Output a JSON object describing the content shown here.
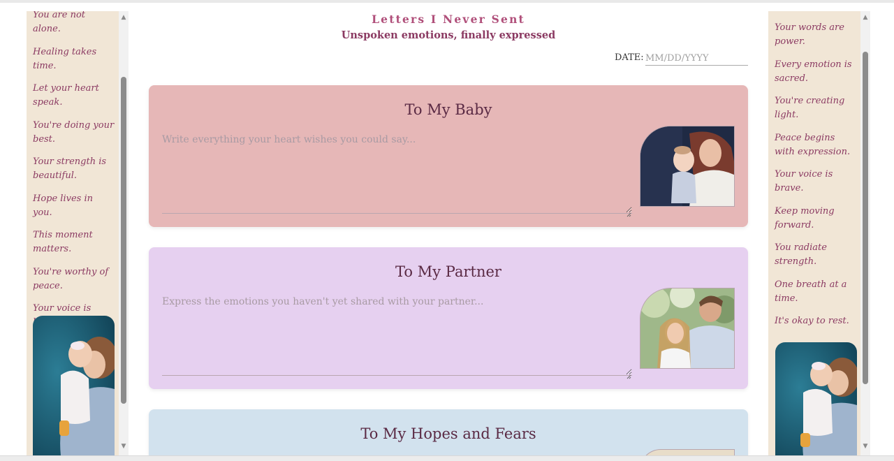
{
  "header": {
    "title": "Letters I Never Sent",
    "subtitle": "Unspoken emotions, finally expressed",
    "date_label": "DATE:",
    "date_placeholder": "MM/DD/YYYY"
  },
  "left_panel": {
    "quotes": [
      "You are not alone.",
      "Healing takes time.",
      "Let your heart speak.",
      "You're doing your best.",
      "Your strength is beautiful.",
      "Hope lives in you.",
      "This moment matters.",
      "You're worthy of peace.",
      "Your voice is healing."
    ],
    "photo_icon": "mother-child-photo"
  },
  "right_panel": {
    "quotes": [
      "Your words are power.",
      "Every emotion is sacred.",
      "You're creating light.",
      "Peace begins with expression.",
      "Your voice is brave.",
      "Keep moving forward.",
      "You radiate strength.",
      "One breath at a time.",
      "It's okay to rest."
    ],
    "photo_icon": "mother-child-photo"
  },
  "cards": [
    {
      "title": "To My Baby",
      "placeholder": "Write everything your heart wishes you could say...",
      "color": "#e6b7b7",
      "photo_icon": "mother-baby-photo"
    },
    {
      "title": "To My Partner",
      "placeholder": "Express the emotions you haven't yet shared with your partner...",
      "color": "#e6d0f0",
      "photo_icon": "couple-photo"
    },
    {
      "title": "To My Hopes and Fears",
      "color": "#d2e2ee",
      "photo_icon": "hopes-photo"
    }
  ],
  "colors": {
    "accent": "#b04f7a",
    "side_panel": "#f1e6d6",
    "quote_text": "#8b3a62"
  }
}
